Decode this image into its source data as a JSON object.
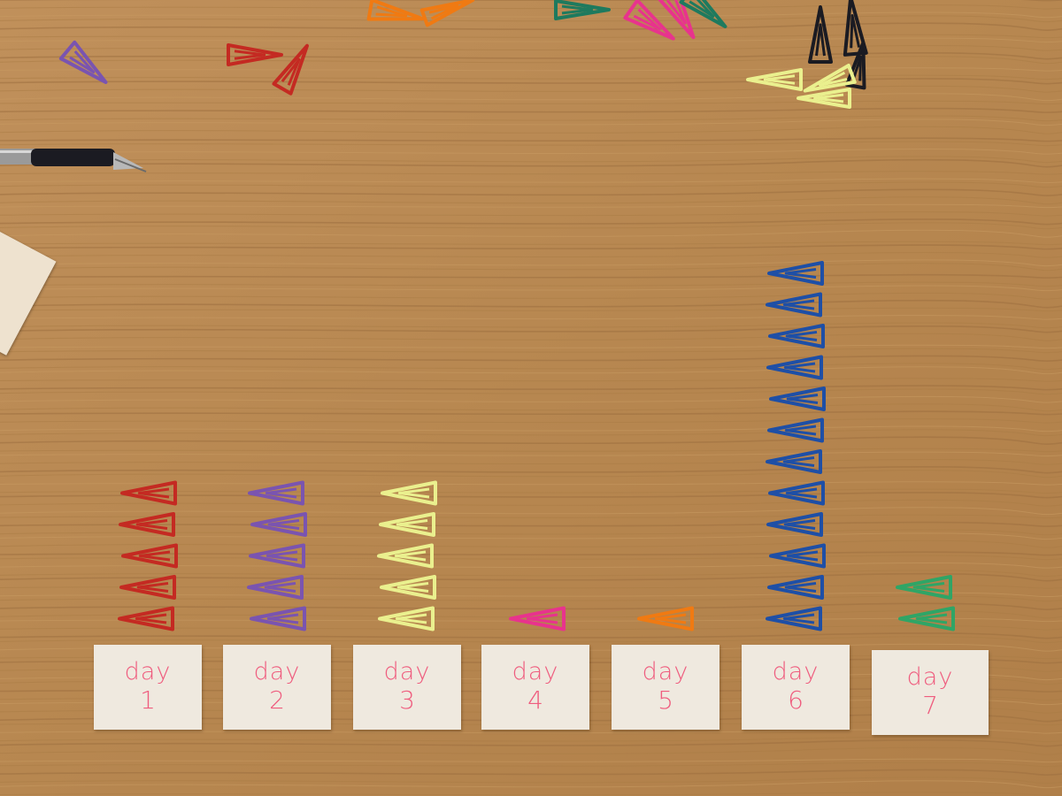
{
  "bars": [
    {
      "day": "day",
      "num": "1",
      "clips": 5,
      "color": "#c42a22"
    },
    {
      "day": "day",
      "num": "2",
      "clips": 5,
      "color": "#7a54b0"
    },
    {
      "day": "day",
      "num": "3",
      "clips": 5,
      "color": "#eaf08e"
    },
    {
      "day": "day",
      "num": "4",
      "clips": 1,
      "color": "#e8338d"
    },
    {
      "day": "day",
      "num": "5",
      "clips": 1,
      "color": "#f07a12"
    },
    {
      "day": "day",
      "num": "6",
      "clips": 12,
      "color": "#1e4fa6"
    },
    {
      "day": "day",
      "num": "7",
      "clips": 2,
      "color": "#2fa566"
    }
  ],
  "colors": {
    "table": "#b98a55",
    "note": "#efe9df",
    "ink": "#ef5c7e"
  },
  "objects": {
    "pen": "pen-icon",
    "scattered_clips": "paperclip-icon"
  }
}
